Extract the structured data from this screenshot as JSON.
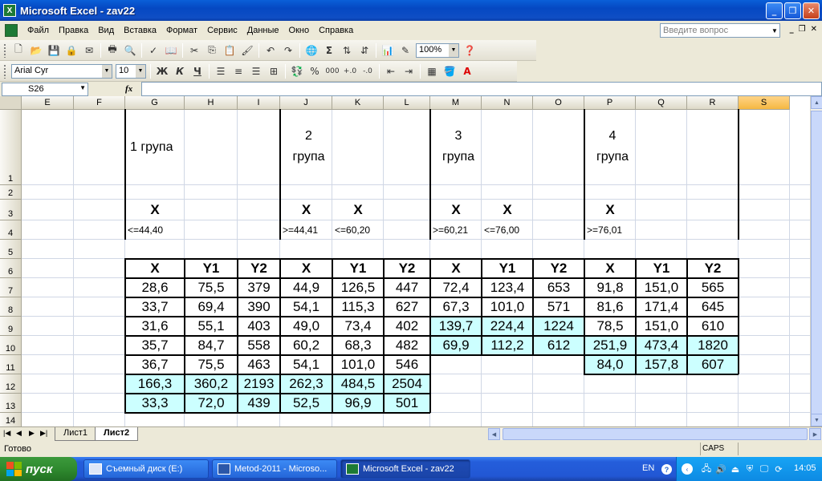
{
  "window": {
    "title": "Microsoft Excel - zav22",
    "app_icon": "excel-icon"
  },
  "menu": [
    "Файл",
    "Правка",
    "Вид",
    "Вставка",
    "Формат",
    "Сервис",
    "Данные",
    "Окно",
    "Справка"
  ],
  "help_box_placeholder": "Введите вопрос",
  "toolbar": {
    "zoom": "100%",
    "font_name": "Arial Cyr",
    "font_size": "10",
    "bold": "Ж",
    "italic": "К",
    "underline": "Ч",
    "sum": "Σ",
    "percent": "%",
    "thousands": "000"
  },
  "formula_bar": {
    "name_box": "S26",
    "fx": "fx",
    "formula": ""
  },
  "grid": {
    "columns": [
      "E",
      "F",
      "G",
      "H",
      "I",
      "J",
      "K",
      "L",
      "M",
      "N",
      "O",
      "P",
      "Q",
      "R",
      "S"
    ],
    "selected_column": "S",
    "rows": [
      "1",
      "2",
      "3",
      "4",
      "5",
      "6",
      "7",
      "8",
      "9",
      "10",
      "11",
      "12",
      "13",
      "14"
    ],
    "cells": {
      "G1": "1 група",
      "J1a": "2",
      "J1b": "група",
      "M1a": "3",
      "M1b": "група",
      "P1a": "4",
      "P1b": "група",
      "G3": "X",
      "J3": "X",
      "K3": "X",
      "M3": "X",
      "N3": "X",
      "P3": "X",
      "G4": "<=44,40",
      "J4": ">=44,41",
      "K4": "<=60,20",
      "M4": ">=60,21",
      "N4": "<=76,00",
      "P4": ">=76,01",
      "G6": "X",
      "H6": "Y1",
      "I6": "Y2",
      "J6": "X",
      "K6": "Y1",
      "L6": "Y2",
      "M6": "X",
      "N6": "Y1",
      "O6": "Y2",
      "P6": "X",
      "Q6": "Y1",
      "R6": "Y2",
      "G7": "28,6",
      "H7": "75,5",
      "I7": "379",
      "J7": "44,9",
      "K7": "126,5",
      "L7": "447",
      "M7": "72,4",
      "N7": "123,4",
      "O7": "653",
      "P7": "91,8",
      "Q7": "151,0",
      "R7": "565",
      "G8": "33,7",
      "H8": "69,4",
      "I8": "390",
      "J8": "54,1",
      "K8": "115,3",
      "L8": "627",
      "M8": "67,3",
      "N8": "101,0",
      "O8": "571",
      "P8": "81,6",
      "Q8": "171,4",
      "R8": "645",
      "G9": "31,6",
      "H9": "55,1",
      "I9": "403",
      "J9": "49,0",
      "K9": "73,4",
      "L9": "402",
      "M9": "139,7",
      "N9": "224,4",
      "O9": "1224",
      "P9": "78,5",
      "Q9": "151,0",
      "R9": "610",
      "G10": "35,7",
      "H10": "84,7",
      "I10": "558",
      "J10": "60,2",
      "K10": "68,3",
      "L10": "482",
      "M10": "69,9",
      "N10": "112,2",
      "O10": "612",
      "P10": "251,9",
      "Q10": "473,4",
      "R10": "1820",
      "G11": "36,7",
      "H11": "75,5",
      "I11": "463",
      "J11": "54,1",
      "K11": "101,0",
      "L11": "546",
      "P11": "84,0",
      "Q11": "157,8",
      "R11": "607",
      "G12": "166,3",
      "H12": "360,2",
      "I12": "2193",
      "J12": "262,3",
      "K12": "484,5",
      "L12": "2504",
      "G13": "33,3",
      "H13": "72,0",
      "I13": "439",
      "J13": "52,5",
      "K13": "96,9",
      "L13": "501"
    },
    "highlight_color": "#ccffff"
  },
  "sheets": {
    "tabs": [
      "Лист1",
      "Лист2"
    ],
    "active": "Лист2"
  },
  "status": {
    "text": "Готово",
    "caps": "CAPS"
  },
  "taskbar": {
    "start": "пуск",
    "items": [
      "Съемный диск (E:)",
      "Metod-2011 - Microso...",
      "Microsoft Excel - zav22"
    ],
    "active_item": "Microsoft Excel - zav22",
    "lang": "EN",
    "clock": "14:05"
  }
}
